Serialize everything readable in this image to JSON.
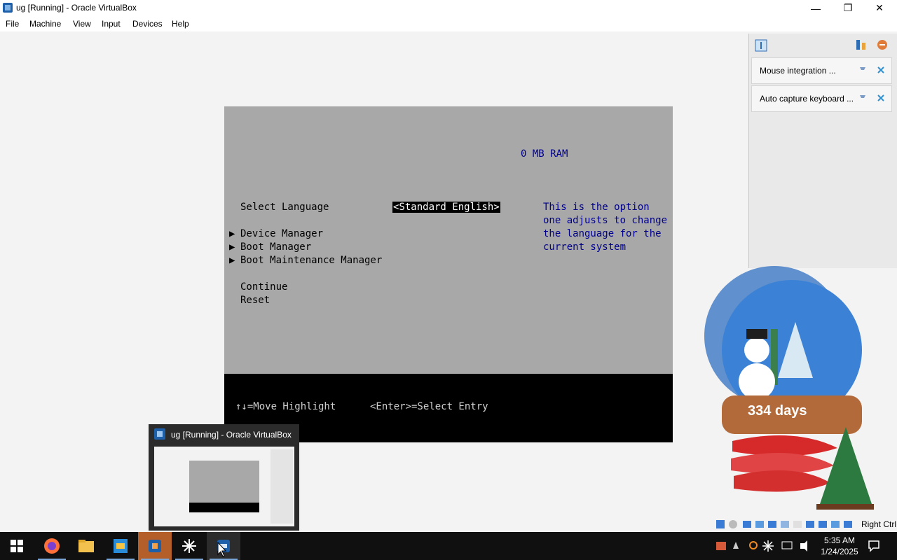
{
  "window": {
    "title": "ug [Running] - Oracle VirtualBox",
    "controls": [
      "minimize-icon",
      "restore-icon",
      "close-icon"
    ]
  },
  "menu": [
    "File",
    "Machine",
    "Input",
    "View",
    "Devices",
    "Help"
  ],
  "menu_order": [
    "File",
    "Machine",
    "View",
    "Input",
    "Devices",
    "Help"
  ],
  "vm": {
    "ram": "0 MB RAM",
    "select_language_label": "Select Language",
    "select_language_value": "<Standard English>",
    "help_lines": [
      "This is the option",
      "one adjusts to change",
      "the language for the",
      "current system"
    ],
    "menu_items": [
      {
        "label": "Device Manager",
        "submenu": true
      },
      {
        "label": "Boot Manager",
        "submenu": true
      },
      {
        "label": "Boot Maintenance Manager",
        "submenu": true
      }
    ],
    "actions": [
      "Continue",
      "Reset"
    ],
    "footer_hint_move": "↑↓=Move Highlight",
    "footer_hint_enter": "<Enter>=Select Entry"
  },
  "notifications": [
    {
      "label": "Mouse integration ..."
    },
    {
      "label": "Auto capture keyboard ..."
    }
  ],
  "thumbnail": {
    "title": "ug [Running] - Oracle VirtualBox"
  },
  "widget": {
    "countdown": "334 days"
  },
  "statusbar": {
    "host_key": "Right Ctrl"
  },
  "taskbar": {
    "apps": [
      "windows-start-icon",
      "firefox-icon",
      "file-explorer-icon",
      "vscode-icon",
      "virtualbox-icon",
      "asterisk-app-icon",
      "virtualbox-x64-icon"
    ],
    "time": "5:35 AM",
    "date": "1/24/2025"
  },
  "colors": {
    "vm_bg": "#a8a8a8",
    "vm_blue_text": "#00008b",
    "taskbar": "#101010"
  }
}
